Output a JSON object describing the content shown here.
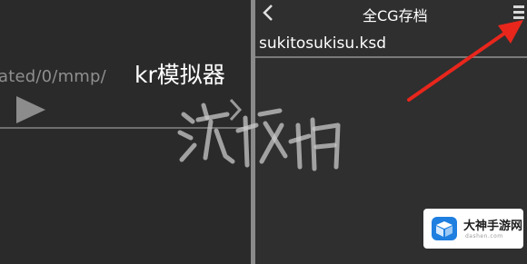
{
  "left_pane": {
    "path_text": "ated/0/mmp/",
    "title": "kr模拟器"
  },
  "right_pane": {
    "header_title": "全CG存档",
    "files": [
      "sukitosukisu.ksd"
    ]
  },
  "watermark": {
    "text": "游戏堡"
  },
  "logo": {
    "name": "大神手游网",
    "domain": "dashen.com"
  },
  "icons": {
    "play": "play-icon",
    "chevron": "chevron-right-icon",
    "back": "back-arrow-icon",
    "menu": "menu-icon",
    "arrow_annotation": "red-arrow-icon"
  },
  "colors": {
    "annotation_red": "#e8261c",
    "logo_blue": "#1f7fe0"
  }
}
